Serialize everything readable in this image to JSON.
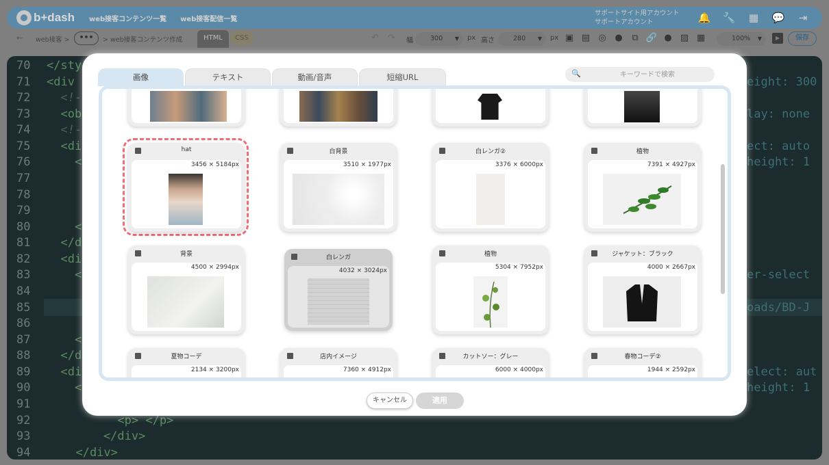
{
  "app": {
    "logo": "b+dash",
    "nav": [
      "web接客コンテンツ一覧",
      "web接客配信一覧"
    ],
    "support": [
      "サポートサイト用アカウント",
      "サポートアカウント"
    ],
    "header_icons": [
      "bell-icon",
      "wrench-icon",
      "grid-icon",
      "chat-icon",
      "logout-icon"
    ]
  },
  "toolbar": {
    "back": "←",
    "crumb1": "web接客 >",
    "crumb_dots": "•••",
    "crumb2": "> web接客コンテンツ作成",
    "tab_html": "HTML",
    "tab_css": "CSS",
    "width_label": "幅",
    "width_value": "300",
    "height_label": "高さ",
    "height_value": "280",
    "unit": "px",
    "zoom": "100%",
    "save": "保存"
  },
  "editor": {
    "line_numbers": [
      "70",
      "71",
      "72",
      "73",
      "74",
      "75",
      "76",
      "77",
      "78",
      "79",
      "80",
      "81",
      "82",
      "83",
      "84",
      "85",
      "86",
      "87",
      "88",
      "89",
      "90",
      "91",
      "92",
      "93",
      "94"
    ],
    "visible_code": {
      "l70": "</sty",
      "l71": "<div",
      "l72": "  <!-",
      "l73": "  <ob",
      "l74": "  <!-",
      "l75": "  <di",
      "l76": "    <",
      "l80": "    <",
      "l81": "  </d",
      "l82": "  <di",
      "l83": "    <",
      "l87": "    <",
      "l88": "  </d",
      "l89": "  <di",
      "l90": "    <",
      "l92": "      <p> </p>",
      "l93": "    </div>",
      "l94": "  </div>"
    },
    "right_code": {
      "r71": "eight: 300",
      "r73": "lay: none",
      "r75": "ect: auto",
      "r76": "height: 1",
      "r83": "er-select",
      "r85": "oads/BD-J",
      "r89": "elect: aut",
      "r90": "height: 1"
    }
  },
  "modal": {
    "tabs": [
      "画像",
      "テキスト",
      "動画/音声",
      "短縮URL"
    ],
    "active_tab": "画像",
    "search_placeholder": "キーワードで検索",
    "cards": [
      {
        "title": "hat",
        "dims": "3456 × 5184px"
      },
      {
        "title": "白背景",
        "dims": "3510 × 1977px"
      },
      {
        "title": "白レンガ②",
        "dims": "3376 × 6000px"
      },
      {
        "title": "植物",
        "dims": "7391 × 4927px"
      },
      {
        "title": "背景",
        "dims": "4500 × 2994px"
      },
      {
        "title": "白レンガ",
        "dims": "4032 × 3024px"
      },
      {
        "title": "植物",
        "dims": "5304 × 7952px"
      },
      {
        "title": "ジャケット：ブラック",
        "dims": "4000 × 2667px"
      },
      {
        "title": "夏物コーデ",
        "dims": "2134 × 3200px"
      },
      {
        "title": "店内イメージ",
        "dims": "7360 × 4912px"
      },
      {
        "title": "カットソー：グレー",
        "dims": "6000 × 4000px"
      },
      {
        "title": "春物コーデ②",
        "dims": "1944 × 2592px"
      }
    ],
    "cancel": "キャンセル",
    "apply": "適用"
  }
}
